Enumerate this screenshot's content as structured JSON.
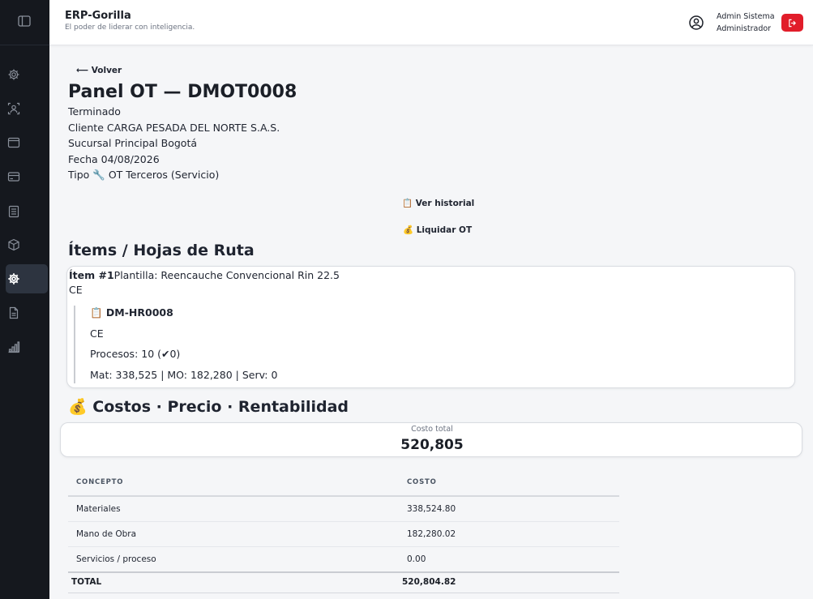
{
  "app": {
    "title": "ERP-Gorilla",
    "tagline": "El poder de liderar con inteligencia."
  },
  "user": {
    "name": "Admin Sistema",
    "role": "Administrador"
  },
  "sidebar": {
    "items": [
      {
        "icon": "gear-icon"
      },
      {
        "icon": "users-icon"
      },
      {
        "icon": "window-icon"
      },
      {
        "icon": "card-icon"
      },
      {
        "icon": "ledger-icon"
      },
      {
        "icon": "cube-icon"
      },
      {
        "icon": "cog-icon",
        "active": true
      },
      {
        "icon": "document-icon"
      },
      {
        "icon": "bar-chart-icon"
      }
    ]
  },
  "nav": {
    "back": "⟵ Volver"
  },
  "ot": {
    "title": "Panel OT — DMOT0008",
    "status": "Terminado",
    "client": "Cliente CARGA PESADA DEL NORTE S.A.S.",
    "branch": "Sucursal Principal Bogotá",
    "date": "Fecha 04/08/2026",
    "type": "Tipo 🔧 OT Terceros (Servicio)"
  },
  "actions": {
    "history": "📋 Ver historial",
    "liquidate": "💰 Liquidar OT"
  },
  "items_section": {
    "title": "Ítems / Hojas de Ruta",
    "items": [
      {
        "label": "Ítem #1",
        "template": "Plantilla: Reencauche Convencional Rin 22.5",
        "code": "CE",
        "route": {
          "title": "📋 DM-HR0008",
          "code": "CE",
          "processes": "Procesos: 10 (✔0)",
          "costs": "Mat: 338,525 | MO: 182,280 | Serv: 0"
        }
      }
    ]
  },
  "costs_section": {
    "title": "💰 Costos · Precio · Rentabilidad",
    "total_label": "Costo total",
    "total_value": "520,805",
    "table": {
      "headers": [
        "CONCEPTO",
        "COSTO"
      ],
      "rows": [
        [
          "Materiales",
          "338,524.80"
        ],
        [
          "Mano de Obra",
          "182,280.02"
        ],
        [
          "Servicios / proceso",
          "0.00"
        ]
      ],
      "total": [
        "TOTAL",
        "520,804.82"
      ]
    }
  }
}
